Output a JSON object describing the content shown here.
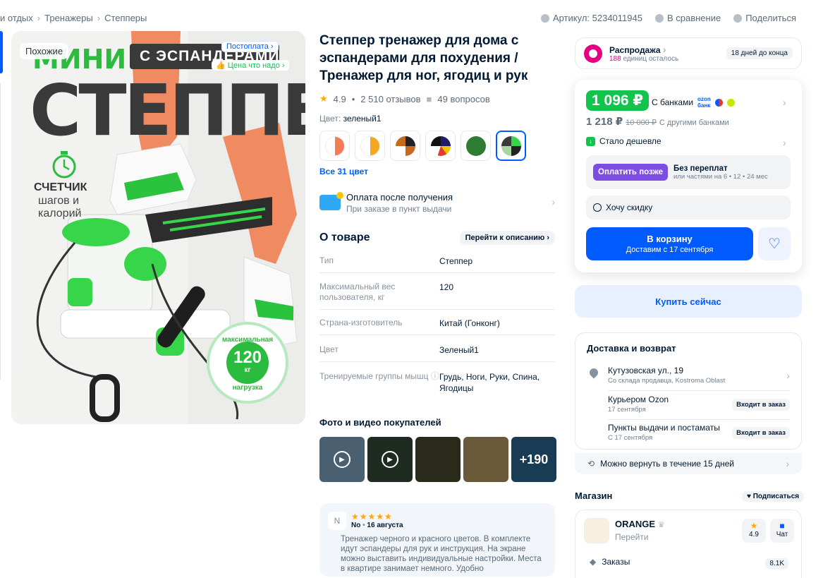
{
  "breadcrumbs": [
    "и отдых",
    "Тренажеры",
    "Степперы"
  ],
  "top_actions": {
    "article": "Артикул: 5234011945",
    "compare": "В сравнение",
    "share": "Поделиться"
  },
  "gallery": {
    "similar": "Похожие",
    "postpay_badge": "Постоплата",
    "price_badge": "Цена что надо",
    "img_mini": "МИНИ",
    "img_expanders": "С ЭСПАНДЕРАМИ",
    "img_stepper": "СТЕППЕР",
    "img_counter": "СЧЕТЧИК",
    "img_counter_sub1": "шагов и",
    "img_counter_sub2": "калорий",
    "img_max": "максимальная",
    "img_load": "нагрузка",
    "img_120": "120",
    "img_kg": "кг"
  },
  "product": {
    "title": "Степпер тренажер для дома с эспандерами для похудения / Тренажер для ног, ягодиц и рук",
    "rating": "4.9",
    "reviews": "2 510 отзывов",
    "questions": "49 вопросов",
    "color_label": "Цвет:",
    "color_value": "зеленый1",
    "all_colors": "Все 31 цвет",
    "swatch_colors": [
      "#f47b55",
      "#f5a623",
      "#c56a1e",
      "#1d1d6b",
      "#2e7d32",
      "#2e6b2e"
    ]
  },
  "payment": {
    "title": "Оплата после получения",
    "subtitle": "При заказе в пункт выдачи"
  },
  "about": {
    "heading": "О товаре",
    "link": "Перейти к описанию",
    "specs": [
      {
        "k": "Тип",
        "v": "Степпер"
      },
      {
        "k": "Максимальный вес пользователя, кг",
        "v": "120"
      },
      {
        "k": "Страна-изготовитель",
        "v": "Китай (Гонконг)"
      },
      {
        "k": "Цвет",
        "v": "Зеленый1"
      },
      {
        "k": "Тренируемые группы мышц",
        "v": "Грудь, Ноги, Руки, Спина, Ягодицы"
      }
    ]
  },
  "photos": {
    "heading": "Фото и видео покупателей",
    "more": "+190"
  },
  "review": {
    "avatar": "N",
    "stars": "★★★★★",
    "author": "No",
    "date": "16 августа",
    "text": "Тренажер черного и красного цветов. В комплекте идут эспандеры для рук и инструкция. На экране можно выставить индивидуальные настройки. Места в квартире занимает немного. Удобно"
  },
  "sale": {
    "title": "Распродажа",
    "count": "188",
    "count_suffix": "единиц осталось",
    "days": "18 дней до конца"
  },
  "price": {
    "card_price": "1 096 ₽",
    "with_banks": "С банками",
    "other_price": "1 218 ₽",
    "old_price": "10 000 ₽",
    "other_banks": "С другими банками",
    "cheaper": "Стало дешевле",
    "pay_later_btn": "Оплатить позже",
    "no_overpay": "Без переплат",
    "installments": "или частями на 6 • 12 • 24 мес",
    "want_discount": "Хочу скидку",
    "cart": "В корзину",
    "cart_delivery": "Доставим с 17 сентября",
    "buy_now": "Купить сейчас"
  },
  "delivery": {
    "heading": "Доставка и возврат",
    "address": "Кутузовская ул., 19",
    "address_sub": "Со склада продавца, Kostroma Oblast",
    "courier": "Курьером Ozon",
    "courier_date": "17 сентября",
    "pickup": "Пункты выдачи и постаматы",
    "pickup_date": "С 17 сентября",
    "included": "Входит в заказ",
    "return": "Можно вернуть в течение 15 дней"
  },
  "shop": {
    "heading": "Магазин",
    "subscribe": "Подписаться",
    "name": "ORANGE",
    "go": "Перейти",
    "rating": "4.9",
    "chat": "Чат",
    "orders": "Заказы",
    "orders_count": "8.1K"
  }
}
